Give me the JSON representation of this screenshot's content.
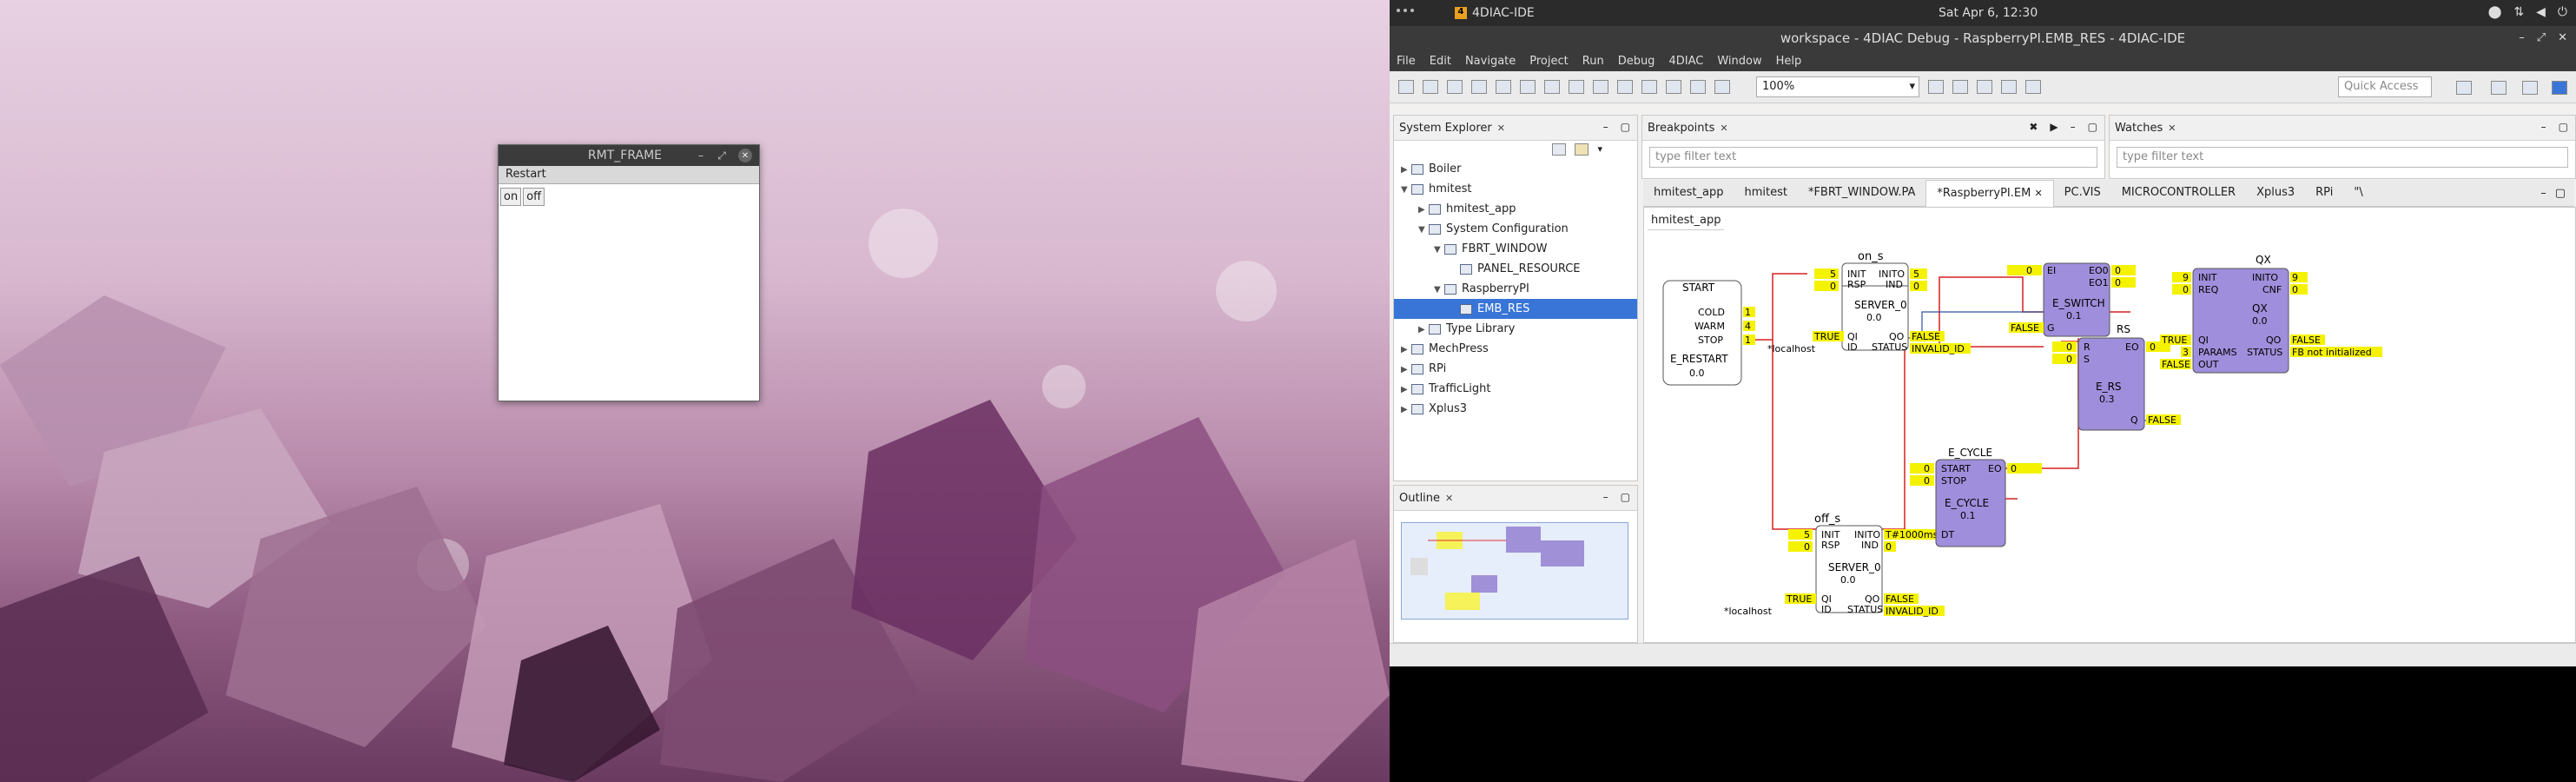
{
  "desktop": {
    "rmt_frame": {
      "title": "RMT_FRAME",
      "restart_label": "Restart",
      "on_label": "on",
      "off_label": "off"
    }
  },
  "topbar": {
    "app_name": "4DIAC-IDE",
    "clock": "Sat Apr 6, 12:30"
  },
  "window": {
    "title": "workspace - 4DIAC Debug - RaspberryPI.EMB_RES - 4DIAC-IDE"
  },
  "menu": [
    "File",
    "Edit",
    "Navigate",
    "Project",
    "Run",
    "Debug",
    "4DIAC",
    "Window",
    "Help"
  ],
  "toolbar": {
    "zoom": "100%",
    "quick_access": "Quick Access"
  },
  "system_explorer": {
    "title": "System Explorer",
    "items": [
      {
        "label": "Boiler",
        "depth": 0
      },
      {
        "label": "hmitest",
        "depth": 0
      },
      {
        "label": "hmitest_app",
        "depth": 1
      },
      {
        "label": "System Configuration",
        "depth": 1
      },
      {
        "label": "FBRT_WINDOW",
        "depth": 2
      },
      {
        "label": "PANEL_RESOURCE",
        "depth": 3
      },
      {
        "label": "RaspberryPI",
        "depth": 2
      },
      {
        "label": "EMB_RES",
        "depth": 3
      },
      {
        "label": "Type Library",
        "depth": 1
      },
      {
        "label": "MechPress",
        "depth": 0
      },
      {
        "label": "RPi",
        "depth": 0
      },
      {
        "label": "TrafficLight",
        "depth": 0
      },
      {
        "label": "Xplus3",
        "depth": 0
      }
    ]
  },
  "outline": {
    "title": "Outline"
  },
  "breakpoints": {
    "title": "Breakpoints",
    "filter": "type filter text"
  },
  "watches": {
    "title": "Watches",
    "filter": "type filter text"
  },
  "editor": {
    "tabs": [
      "hmitest_app",
      "hmitest",
      "*FBRT_WINDOW.PA",
      "*RaspberryPI.EM",
      "PC.VIS",
      "MICROCONTROLLER",
      "Xplus3",
      "RPi",
      "\"\\"
    ],
    "breadcrumb": "hmitest_app"
  },
  "fbs": {
    "on_s": {
      "name": "on_s",
      "type": "SERVER_0",
      "ver": "0.0",
      "inputs": [
        "INIT",
        "RSP",
        "QI",
        "ID"
      ],
      "outputs": [
        "INITO",
        "IND",
        "QO",
        "STATUS"
      ]
    },
    "off_s": {
      "name": "off_s",
      "type": "SERVER_0",
      "ver": "0.0",
      "inputs": [
        "INIT",
        "RSP",
        "QI",
        "ID"
      ],
      "outputs": [
        "INITO",
        "IND",
        "QO",
        "STATUS"
      ]
    },
    "start": {
      "name": "START",
      "type": "E_RESTART",
      "ver": "0.0",
      "outputs": [
        "COLD",
        "WARM",
        "STOP"
      ]
    },
    "e_cycle": {
      "name": "E_CYCLE",
      "type": "E_CYCLE",
      "ver": "0.1",
      "inputs": [
        "START",
        "STOP",
        "DT"
      ],
      "outputs": [
        "EO"
      ]
    },
    "e_switch": {
      "type": "E_SWITCH",
      "ver": "0.1",
      "inputs": [
        "EI",
        "G"
      ],
      "outputs": [
        "EO0",
        "EO1"
      ]
    },
    "rs": {
      "name": "RS",
      "type": "E_RS",
      "ver": "0.3",
      "inputs": [
        "R",
        "S"
      ],
      "outputs": [
        "EO",
        "Q"
      ]
    },
    "qx": {
      "name": "QX",
      "type": "QX",
      "ver": "0.0",
      "inputs": [
        "INIT",
        "REQ",
        "QI",
        "PARAMS",
        "OUT"
      ],
      "outputs": [
        "INITO",
        "CNF",
        "QO",
        "STATUS"
      ]
    }
  },
  "watch_values": {
    "five": "5",
    "zero": "0",
    "one": "1",
    "four": "4",
    "nine": "9",
    "three": "3",
    "true": "TRUE",
    "false": "FALSE",
    "invalid": "INVALID_ID",
    "localhost": "*localhost",
    "dt": "T#1000ms",
    "fb_status": "FB not initialized"
  }
}
